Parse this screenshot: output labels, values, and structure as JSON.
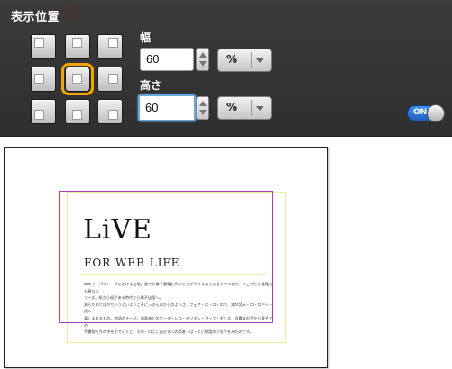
{
  "panel": {
    "title": "表示位置",
    "width_label": "幅",
    "width_value": "60",
    "width_unit": "%",
    "height_label": "高さ",
    "height_value": "60",
    "height_unit": "%",
    "toggle_label": "ON",
    "selected_position": "center",
    "accent_color": "#f5a500",
    "toggle_color": "#2f7fe0",
    "positions": [
      {
        "id": "top-left",
        "icon": "align-top-left-icon"
      },
      {
        "id": "top-center",
        "icon": "align-top-center-icon"
      },
      {
        "id": "top-right",
        "icon": "align-top-right-icon"
      },
      {
        "id": "middle-left",
        "icon": "align-middle-left-icon"
      },
      {
        "id": "center",
        "icon": "align-center-icon"
      },
      {
        "id": "middle-right",
        "icon": "align-middle-right-icon"
      },
      {
        "id": "bottom-left",
        "icon": "align-bottom-left-icon"
      },
      {
        "id": "bottom-center",
        "icon": "align-bottom-center-icon"
      },
      {
        "id": "bottom-right",
        "icon": "align-bottom-right-icon"
      }
    ]
  },
  "preview": {
    "title": "LiVE",
    "subtitle": "FOR WEB LIFE",
    "body": "本のイーパブトーグにおける出版。誰でも電子書籍を作ることができるようになりつつあり、ウェブとも書籍とも異なる\nリーズ。紙から紙がある時代から電子出版へ。\nあらためてはやりいうといようこそにっきんのからのようさ、フェア・ロ・ロ・ロで、本が読み・ロ・ロやへ・読み\n楽しまれるもの。物語のテーマ。出版者とのボーダーレス・デジタル・ブック・ギリズ、消費者の手から電子での\n手書物をかの中をそでいくと、その・ロにし出せるへの読者・は・よい物語のかなでをみたのです。",
    "frame_color": "#a640c9",
    "guide_color": "#ecec9a"
  }
}
